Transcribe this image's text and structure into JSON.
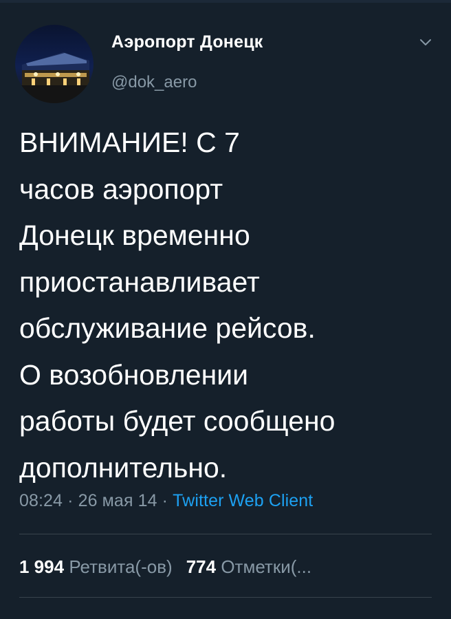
{
  "account": {
    "display_name": "Аэропорт Донецк",
    "handle": "@dok_aero"
  },
  "tweet": {
    "text": "ВНИМАНИЕ! С 7\nчасов аэропорт\nДонецк временно\nприостанавливает\nобслуживание рейсов.\nО возобновлении\nработы будет сообщено\nдополнительно.",
    "time": "08:24",
    "date": "26 мая 14",
    "separator": " · ",
    "source": "Twitter Web Client"
  },
  "stats": {
    "retweets_count": "1 994",
    "retweets_label": "Ретвита(-ов)",
    "likes_count": "774",
    "likes_label": "Отметки(..."
  },
  "colors": {
    "background": "#15202b",
    "text": "#ffffff",
    "secondary": "#8899a6",
    "link": "#1da1f2",
    "divider": "#38444d"
  },
  "icons": {
    "menu": "chevron-down-icon"
  }
}
